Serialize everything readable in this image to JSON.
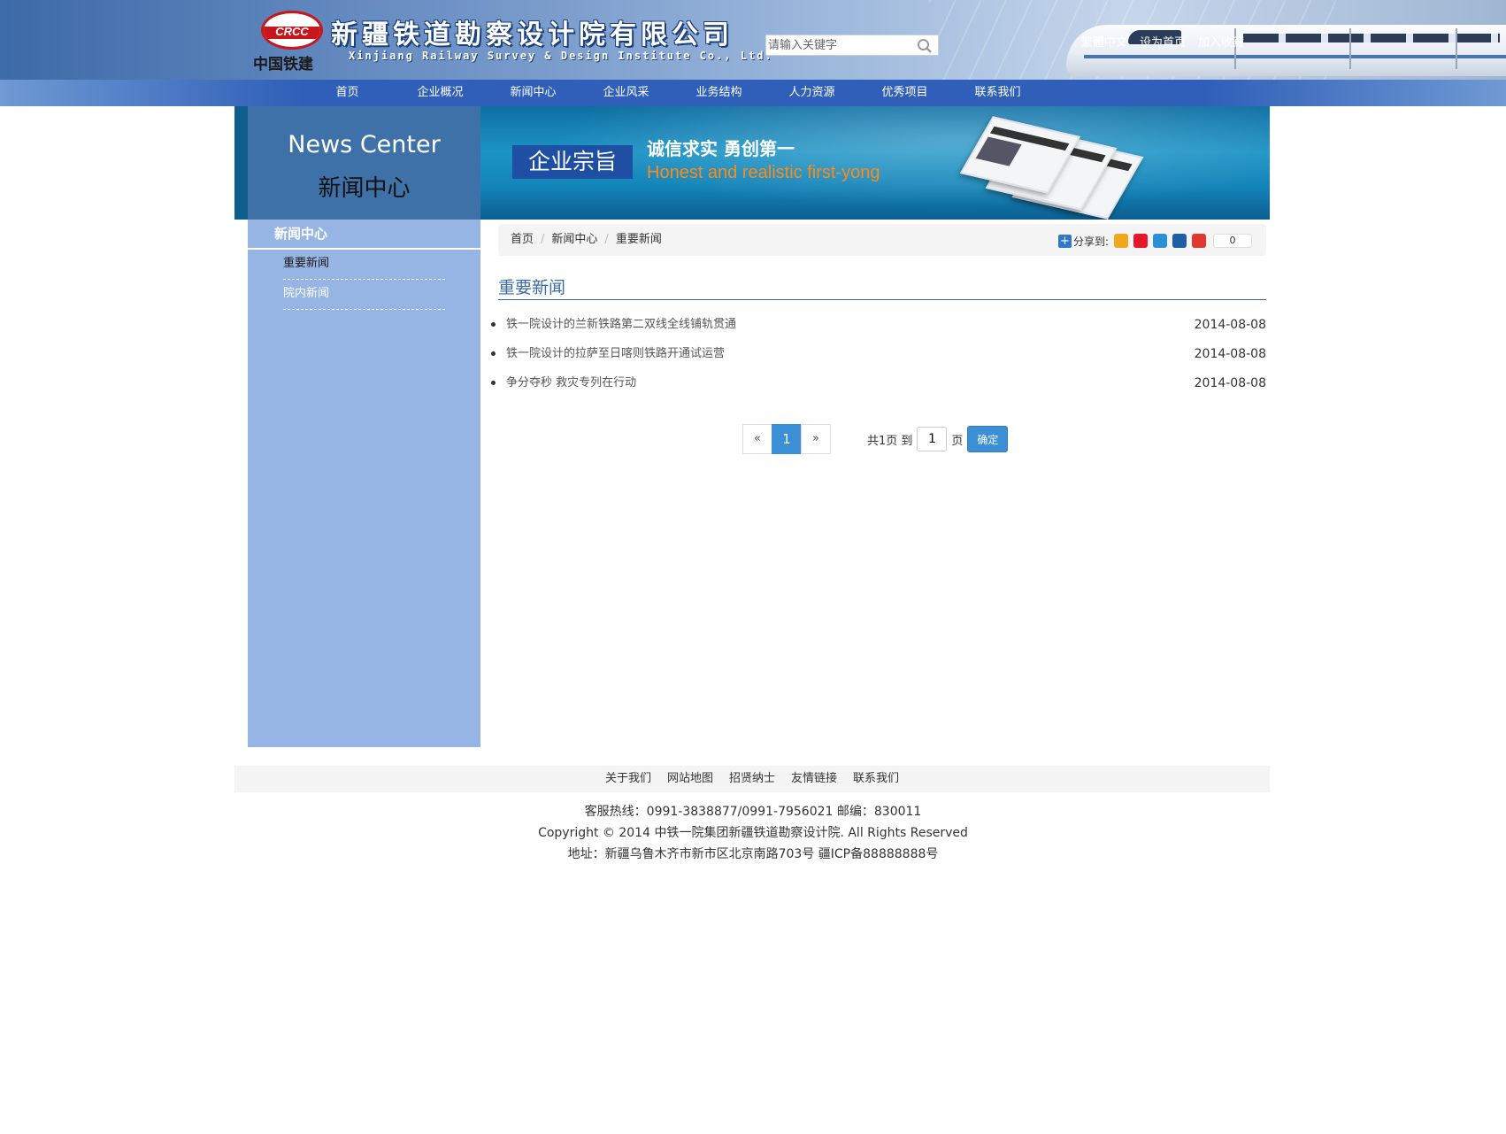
{
  "header": {
    "logo_text": "CRCC",
    "logo_cn": "中国铁建",
    "company_cn": "新疆铁道勘察设计院有限公司",
    "company_en": "Xinjiang Railway Survey & Design Institute Co., Ltd.",
    "search_placeholder": "请输入关键字",
    "top_links": [
      "繁體中文",
      "设为首页",
      "加入收藏"
    ]
  },
  "nav": {
    "items": [
      "首页",
      "企业概况",
      "新闻中心",
      "企业风采",
      "业务结构",
      "人力资源",
      "优秀项目",
      "联系我们"
    ]
  },
  "banner": {
    "en_title": "News Center",
    "cn_title": "新闻中心",
    "tag": "企业宗旨",
    "slogan": "诚信求实 勇创第一",
    "slogan_en": "Honest and realistic first-yong"
  },
  "sidebar": {
    "title": "新闻中心",
    "items": [
      "重要新闻",
      "院内新闻"
    ]
  },
  "breadcrumb": {
    "items": [
      "首页",
      "新闻中心",
      "重要新闻"
    ],
    "separator": "/"
  },
  "share": {
    "label": "分享到:",
    "count": "0",
    "icons": [
      "qzone-icon",
      "weibo-icon",
      "tencent-weibo-icon",
      "renren-icon",
      "tqq-icon"
    ],
    "colors": [
      "#f0a81e",
      "#e6162d",
      "#2c8fd6",
      "#1e5ea8",
      "#e0372f"
    ]
  },
  "main": {
    "section_title": "重要新闻",
    "news": [
      {
        "title": "铁一院设计的兰新铁路第二双线全线铺轨贯通",
        "date": "2014-08-08"
      },
      {
        "title": "铁一院设计的拉萨至日喀则铁路开通试运营",
        "date": "2014-08-08"
      },
      {
        "title": "争分夺秒 救灾专列在行动",
        "date": "2014-08-08"
      }
    ]
  },
  "pagination": {
    "prev": "«",
    "current": "1",
    "next": "»",
    "total_label": "共1页 到",
    "page_value": "1",
    "page_suffix": "页",
    "go_label": "确定"
  },
  "footer": {
    "links": [
      "关于我们",
      "网站地图",
      "招贤纳士",
      "友情链接",
      "联系我们"
    ],
    "hotline": "客服热线：0991-3838877/0991-7956021 邮编：830011",
    "copyright": "Copyright © 2014 中铁一院集团新疆铁道勘察设计院. All Rights Reserved",
    "address": "地址：新疆乌鲁木齐市新市区北京南路703号 疆ICP备88888888号"
  },
  "colors": {
    "nav_bg": "#2f5fb8",
    "sidebar_bg": "#97b5e4",
    "accent": "#3a8fd6",
    "title_blue": "#3a6aa8",
    "slogan_orange": "#ff8a18"
  }
}
